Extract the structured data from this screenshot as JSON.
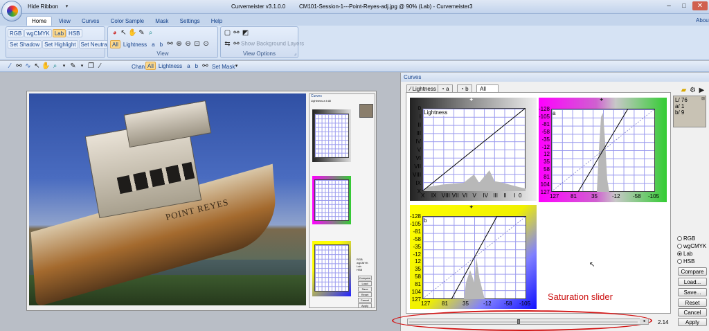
{
  "window": {
    "title": "Curvemeister v3.1.0.0",
    "document": "CM101-Session-1---Point-Reyes-adj.jpg @ 90% (Lab) - Curvemeister3",
    "about": "About",
    "hide_ribbon": "Hide Ribbon"
  },
  "ribbon": {
    "tabs": [
      "Home",
      "View",
      "Curves",
      "Color Sample",
      "Mask",
      "Settings",
      "Help"
    ],
    "active_tab": "Home",
    "color_modes": [
      "RGB",
      "wgCMYK",
      "Lab",
      "HSB"
    ],
    "active_mode": "Lab",
    "sample_buttons": [
      "Set Shadow",
      "Set Highlight",
      "Set Neutral"
    ],
    "view_channels": [
      "All",
      "Lightness",
      "a",
      "b"
    ],
    "view_group_label": "View",
    "view_options_label": "View Options",
    "show_background_layers": "Show Background Layers"
  },
  "toolbar": {
    "chan_label": "Chan:",
    "channels": [
      "All",
      "Lightness",
      "a",
      "b"
    ],
    "active_channel": "All",
    "set_mask": "Set Mask"
  },
  "curves_panel": {
    "title": "Curves",
    "tabs": [
      "Lightness",
      "a",
      "b",
      "All"
    ],
    "active_tab": "All",
    "lightness": {
      "label": "Lightness",
      "y_ticks": [
        "0",
        "I",
        "II",
        "III",
        "IV",
        "V",
        "VI",
        "VII",
        "VIII",
        "IX",
        "X"
      ],
      "x_ticks": [
        "X",
        "IX",
        "VIII",
        "VII",
        "VI",
        "V",
        "IV",
        "III",
        "II",
        "I",
        "0"
      ]
    },
    "a": {
      "label": "a",
      "y_ticks": [
        "-128",
        "-105",
        "-81",
        "-58",
        "-35",
        "-12",
        "12",
        "35",
        "58",
        "81",
        "104",
        "127"
      ],
      "x_ticks": [
        "127",
        "81",
        "35",
        "-12",
        "-58",
        "-105"
      ]
    },
    "b": {
      "label": "b",
      "y_ticks": [
        "-128",
        "-105",
        "-81",
        "-58",
        "-35",
        "-12",
        "12",
        "35",
        "58",
        "81",
        "104",
        "127"
      ],
      "x_ticks": [
        "127",
        "81",
        "35",
        "-12",
        "-58",
        "-105"
      ]
    },
    "readout": {
      "L": "L/ 76",
      "a": "a/ 1",
      "b": "b/ 9"
    },
    "radios": [
      "RGB",
      "wgCMYK",
      "Lab",
      "HSB"
    ],
    "selected_radio": "Lab",
    "buttons": [
      "Compare",
      "Load...",
      "Save...",
      "Reset",
      "Cancel",
      "Apply"
    ],
    "slider_value": "2.14",
    "slider_fraction": 0.48
  },
  "annotation": {
    "text": "Saturation slider",
    "color": "#cc1010"
  },
  "photo": {
    "caption": "POINT REYES"
  },
  "mini_panel": {
    "title": "Curves",
    "tabs": [
      "Lightness",
      "a",
      "b",
      "All"
    ],
    "radios": [
      "RGB",
      "wgCMYK",
      "Lab",
      "HSB"
    ],
    "buttons": [
      "Compare",
      "Load",
      "Save",
      "Reset",
      "Cancel",
      "Apply"
    ]
  }
}
